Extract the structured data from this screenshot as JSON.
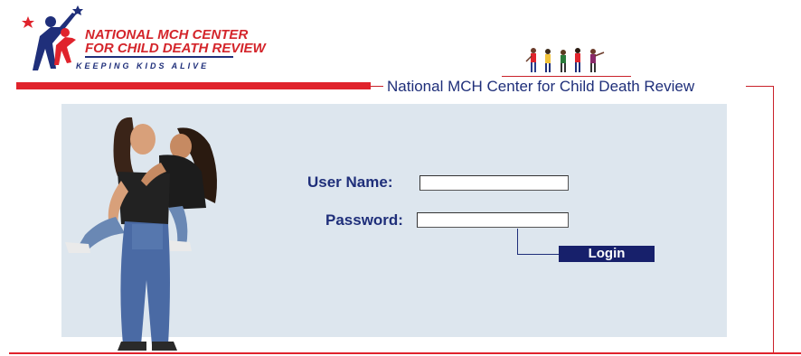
{
  "logo": {
    "line1": "NATIONAL MCH CENTER",
    "line2": "FOR CHILD DEATH REVIEW",
    "tagline": "KEEPING KIDS ALIVE"
  },
  "header": {
    "title": "National MCH Center for Child Death Review"
  },
  "form": {
    "username_label": "User Name:",
    "password_label": "Password:",
    "username_value": "",
    "password_value": "",
    "login_label": "Login"
  },
  "colors": {
    "brand_red": "#e0232c",
    "brand_navy": "#1f2f7a",
    "panel_bg": "#dde6ee",
    "button_bg": "#17206b"
  }
}
